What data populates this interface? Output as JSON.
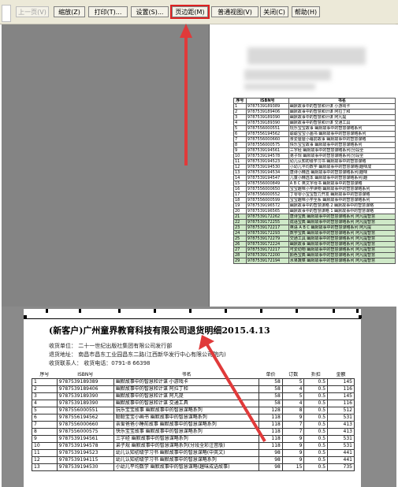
{
  "toolbar": {
    "prev_page": "上一页(V)",
    "zoom": "缩放(Z)",
    "print": "打印(T)...",
    "setup": "设置(S)...",
    "margins": "页边距(M)",
    "normal_view": "普通视图(V)",
    "close": "关闭(C)",
    "help": "帮助(H)"
  },
  "preview_small": {
    "headers": [
      "序号",
      "ISBN号",
      "书名"
    ],
    "rows": [
      [
        "1",
        "9787539189389",
        "幽默故事中的智慧和计谋 小游戏卡"
      ],
      [
        "2",
        "9787539189406",
        "幽默故事中的智慧和计谋 阿拉丁和"
      ],
      [
        "3",
        "9787539189390",
        "幽默故事中的智慧和计谋 阿凡提"
      ],
      [
        "4",
        "9787539189390",
        "幽默故事中的智慧和计谋 交通工具"
      ],
      [
        "5",
        "9787556000551",
        "玩乐宝宝故事 幽默故事中的智慧谋略系列"
      ],
      [
        "6",
        "9787556194562",
        "聪聪宝宝小画书 幽默故事中的智慧谋略系列"
      ],
      [
        "7",
        "9787556000660",
        "亲爱爸爸小睡前故事 幽默故事中的智慧谋略"
      ],
      [
        "8",
        "9787556000575",
        "快乐宝宝故事 幽默故事中的智慧谋略系列"
      ],
      [
        "9",
        "9787539194561",
        "三字经 幽默故事中的智慧谋略系列(分段全"
      ],
      [
        "10",
        "9787539194578",
        "弟子规 幽默故事中的智慧谋略系列(分段全"
      ],
      [
        "11",
        "9787539194523",
        "幼儿认知初级学习书 幽默故事中的智慧谋略"
      ],
      [
        "12",
        "9787539194530",
        "小幼儿平均数学 幽默故事中的智慧谋略(趣味成"
      ],
      [
        "13",
        "9787539194534",
        "唐诗小精选 幽默故事中的智慧谋略系列(趣味"
      ],
      [
        "14",
        "9787539194547",
        "儿童小精选本 幽默故事中的智慧谋略系列(趣"
      ],
      [
        "15",
        "9787556000849",
        "A B C 英文字母书 幽默故事中的智慧谋略"
      ],
      [
        "16",
        "9787556000650",
        "宝宝趣味小学读物 幽默故事中的智慧谋略系列"
      ],
      [
        "17",
        "9787556000552",
        "丁零零小宝宝智力开发 幽默故事中的智慧谋略"
      ],
      [
        "18",
        "9787556000599",
        "宝宝趣味小学全系 幽默故事中的智慧谋略系列"
      ],
      [
        "19",
        "9787539196572",
        "幽默故事中的智慧谋略 2 幽默故事中的智慧谋略"
      ],
      [
        "20",
        "9787539196565",
        "幽默故事中的智慧谋略 1 幽默故事中的智慧谋略"
      ],
      [
        "21",
        "9787539172262",
        "唐诗宝典 幽默故事中的智慧谋略系列 阿凡提智慧"
      ],
      [
        "22",
        "9787539172255",
        "成语宝典 幽默故事中的智慧谋略系列 阿凡提智慧"
      ],
      [
        "23",
        "9787539172217",
        "英语 A B C 幽默故事中的智慧谋略系列 阿凡提"
      ],
      [
        "24",
        "9787539172293",
        "数学宝典 幽默故事中的智慧谋略系列 阿凡提智慧"
      ],
      [
        "25",
        "9787539172279",
        "交通工具 幽默故事中的智慧谋略系列 阿凡提智慧"
      ],
      [
        "26",
        "9787539172224",
        "幽默故事 幽默故事中的智慧谋略系列 阿凡提智慧"
      ],
      [
        "27",
        "9787539172217",
        "可爱动物 幽默故事中的智慧谋略系列 阿凡提智慧"
      ],
      [
        "28",
        "9787539172200",
        "颜色宝典 幽默故事中的智慧谋略系列 阿凡提智慧"
      ],
      [
        "29",
        "9787539172194",
        "水果蔬菜 幽默故事中的智慧谋略系列 阿凡提智慧"
      ]
    ]
  },
  "preview_large": {
    "title": "(新客户)广州童界教育科技有限公司退货明细2015.4.13",
    "info_line1": "收货单位：  二十一世纪出版社集团有限公司发行部",
    "info_line2": "退货地址：  南昌市昌东工业园昌东二路(江西新华发行中心有限公司院内)",
    "info_line3": "收货联系人：        收货电话：0791-8   66398",
    "headers": [
      "序号",
      "ISBN号",
      "书名",
      "单价",
      "订数",
      "折扣",
      "金额"
    ],
    "rows": [
      [
        "1",
        "9787539189389",
        "幽默故事中的智慧和计谋 小游戏卡",
        "58",
        "5",
        "0.5",
        "145"
      ],
      [
        "2",
        "9787539189406",
        "幽默故事中的智慧和计谋 阿拉丁和",
        "58",
        "4",
        "0.5",
        "116"
      ],
      [
        "3",
        "9787539189390",
        "幽默故事中的智慧和计谋 阿凡提",
        "58",
        "5",
        "0.5",
        "145"
      ],
      [
        "4",
        "9787539189390",
        "幽默故事中的智慧和计谋 交通工具",
        "58",
        "4",
        "0.5",
        "116"
      ],
      [
        "5",
        "9787556000551",
        "玩乐宝宝故事 幽默故事中的智慧谋略系列",
        "128",
        "8",
        "0.5",
        "512"
      ],
      [
        "6",
        "9787556194562",
        "聪聪宝宝小画书 幽默故事中的智慧谋略系列",
        "118",
        "9",
        "0.5",
        "531"
      ],
      [
        "7",
        "9787556000660",
        "亲爱爸爸小睡前故事 幽默故事中的智慧谋略系列",
        "118",
        "7",
        "0.5",
        "413"
      ],
      [
        "8",
        "9787556000575",
        "快乐宝宝故事 幽默故事中的智慧谋略系列",
        "118",
        "7",
        "0.5",
        "413"
      ],
      [
        "9",
        "9787539194561",
        "三字经 幽默故事中的智慧谋略系列",
        "118",
        "9",
        "0.5",
        "531"
      ],
      [
        "10",
        "9787539194578",
        "弟子规 幽默故事中的智慧谋略系列(分段全彩注音版)",
        "118",
        "9",
        "0.5",
        "531"
      ],
      [
        "11",
        "9787539194523",
        "幼儿认知初级学习书 幽默故事中的智慧谋略(中英文)",
        "98",
        "9",
        "0.5",
        "441"
      ],
      [
        "12",
        "9787539194115",
        "幼儿认知初级学习书 幽默故事中的智慧谋略系列",
        "98",
        "9",
        "0.5",
        "441"
      ],
      [
        "13",
        "9787539194530",
        "小幼儿平均数学 幽默故事中的智慧谋略(趣味成语故事)",
        "98",
        "15",
        "0.5",
        "735"
      ]
    ]
  }
}
